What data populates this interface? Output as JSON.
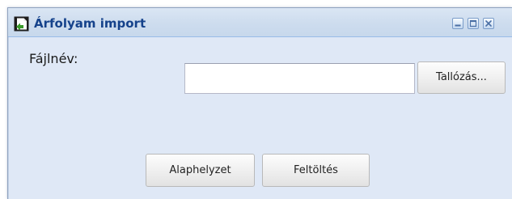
{
  "window": {
    "title": "Árfolyam import",
    "icon": "document-import-icon",
    "tools": [
      "minimize-icon",
      "maximize-icon",
      "close-icon"
    ]
  },
  "form": {
    "filename_label": "Fájlnév:",
    "filename_value": "",
    "browse_label": "Tallózás..."
  },
  "actions": {
    "reset_label": "Alaphelyzet",
    "upload_label": "Feltöltés"
  },
  "colors": {
    "title_text": "#15428b",
    "window_body": "#dfe8f6",
    "titlebar": "#cddcee"
  }
}
